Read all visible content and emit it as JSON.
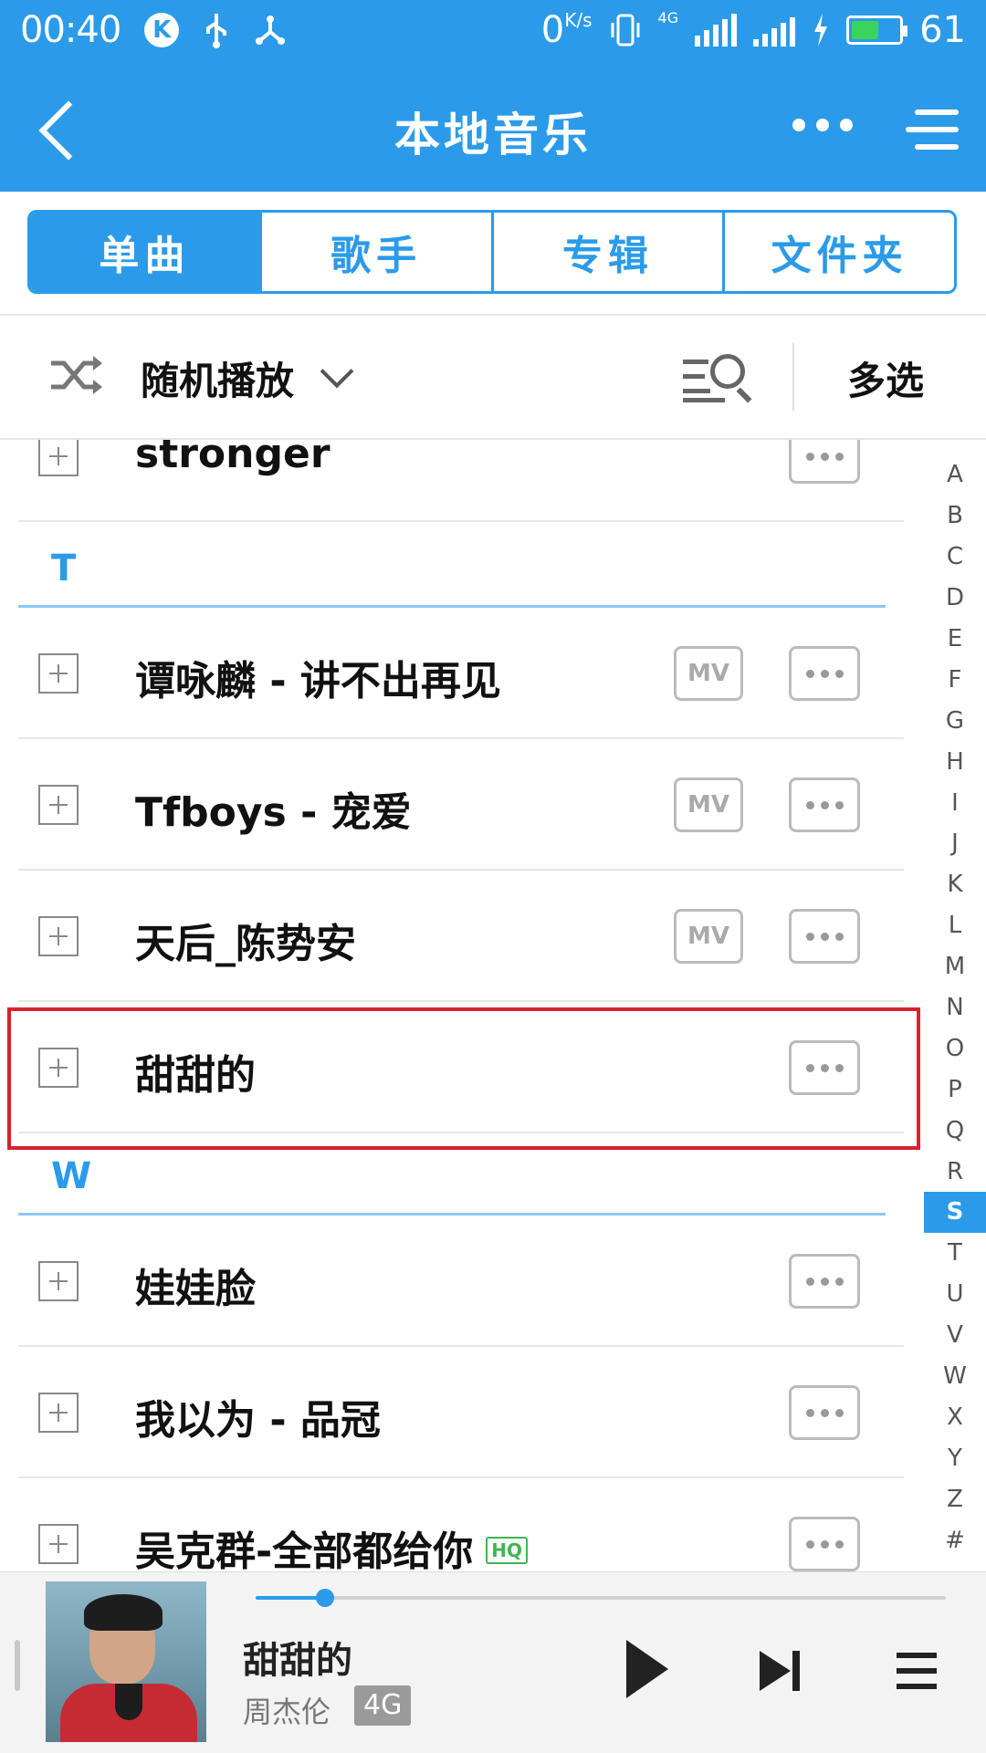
{
  "status_bar": {
    "time": "00:40",
    "net_speed": "0",
    "net_speed_unit": "K/s",
    "network_type": "4G",
    "battery_percent": "61",
    "battery_level": 0.61,
    "icons": [
      "k-app-icon",
      "usb-icon",
      "share-icon",
      "vibrate-icon",
      "signal-icon",
      "signal-icon",
      "charging-icon",
      "battery-icon"
    ]
  },
  "header": {
    "title": "本地音乐",
    "back_icon": "back-arrow-icon",
    "more_icon": "more-dots-icon",
    "menu_icon": "menu-icon"
  },
  "tabs": [
    {
      "label": "单曲",
      "active": true
    },
    {
      "label": "歌手",
      "active": false
    },
    {
      "label": "专辑",
      "active": false
    },
    {
      "label": "文件夹",
      "active": false
    }
  ],
  "toolbar": {
    "shuffle_icon": "shuffle-icon",
    "play_mode": "随机播放",
    "search_icon": "search-list-icon",
    "multi_select": "多选"
  },
  "songs": {
    "stronger": {
      "title": "stronger",
      "mv": false
    },
    "section_t": "T",
    "t1": {
      "title": "谭咏麟 - 讲不出再见",
      "mv": true
    },
    "t2": {
      "title": "Tfboys - 宠爱",
      "mv": true
    },
    "t3": {
      "title": "天后_陈势安",
      "mv": true
    },
    "t4": {
      "title": "甜甜的",
      "mv": false
    },
    "section_w": "W",
    "w1": {
      "title": "娃娃脸",
      "mv": false
    },
    "w2": {
      "title": "我以为 - 品冠",
      "mv": false
    },
    "w3": {
      "title": "吴克群-全部都给你",
      "mv": false,
      "badge": "HQ"
    },
    "mv_label": "MV"
  },
  "alphabet_index": [
    "A",
    "B",
    "C",
    "D",
    "E",
    "F",
    "G",
    "H",
    "I",
    "J",
    "K",
    "L",
    "M",
    "N",
    "O",
    "P",
    "Q",
    "R",
    "S",
    "T",
    "U",
    "V",
    "W",
    "X",
    "Y",
    "Z",
    "#"
  ],
  "alphabet_active": "S",
  "now_playing": {
    "title": "甜甜的",
    "artist": "周杰伦",
    "quality_badge": "4G",
    "progress": 0.1
  },
  "colors": {
    "accent": "#2b9be9",
    "highlight_border": "#d6222e",
    "hq_green": "#3fb54f"
  }
}
